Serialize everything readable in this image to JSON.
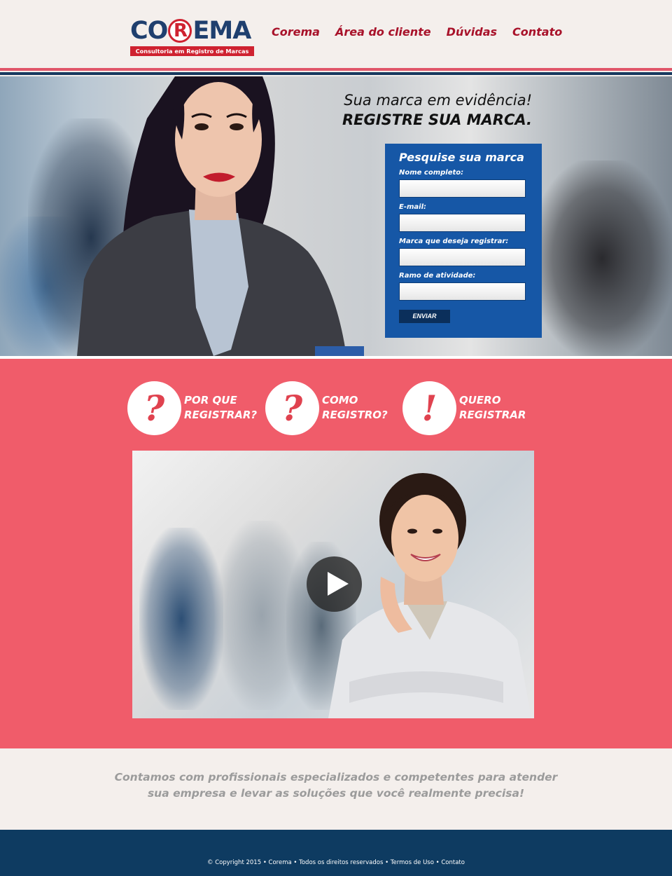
{
  "colors": {
    "brand_red": "#cf2230",
    "brand_blue": "#1f3f6e",
    "pink": "#f05c6a",
    "form_blue": "#1657a6",
    "footer_navy": "#0e3b61"
  },
  "header": {
    "logo": {
      "word_left": "CO",
      "word_r": "R",
      "word_right": "EMA",
      "subtitle": "Consultoria em Registro de Marcas"
    },
    "nav": [
      {
        "label": "Corema"
      },
      {
        "label": "Área do cliente"
      },
      {
        "label": "Dúvidas"
      },
      {
        "label": "Contato"
      }
    ]
  },
  "hero": {
    "tagline_line1": "Sua marca em evidência!",
    "tagline_line2": "REGISTRE SUA MARCA.",
    "form": {
      "title": "Pesquise sua marca",
      "fields": [
        {
          "label": "Nome completo:",
          "value": ""
        },
        {
          "label": "E-mail:",
          "value": ""
        },
        {
          "label": "Marca que deseja registrar:",
          "value": ""
        },
        {
          "label": "Ramo de atividade:",
          "value": ""
        }
      ],
      "submit_label": "ENVIAR"
    }
  },
  "features": [
    {
      "icon": "question-icon",
      "glyph": "?",
      "line1": "POR QUE",
      "line2": "REGISTRAR?"
    },
    {
      "icon": "question-icon",
      "glyph": "?",
      "line1": "COMO",
      "line2": "REGISTRO?"
    },
    {
      "icon": "exclamation-icon",
      "glyph": "!",
      "line1": "QUERO",
      "line2": "REGISTRAR"
    }
  ],
  "video": {
    "icon": "play-icon"
  },
  "about": {
    "line1": "Contamos com profissionais especializados e competentes para atender",
    "line2": "sua empresa e levar as soluções que você realmente precisa!"
  },
  "footer": {
    "copyright": "© Copyright 2015 • Corema • Todos os direitos reservados • Termos de Uso • Contato"
  }
}
